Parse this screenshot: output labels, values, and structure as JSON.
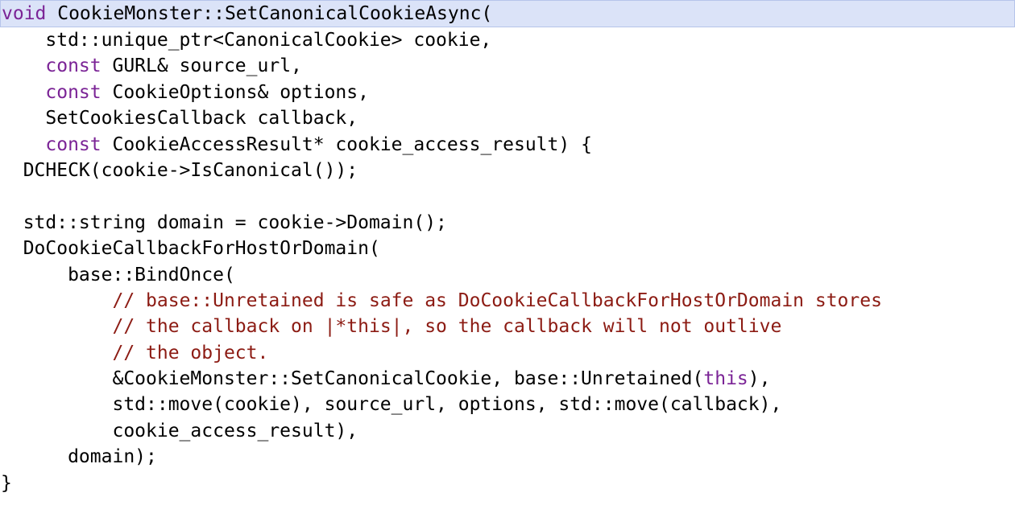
{
  "colors": {
    "keyword": "#7b2496",
    "comment": "#8c1b13",
    "text": "#000000",
    "highlight_background": "#dbe3f8",
    "highlight_border": "#b6c4ea"
  },
  "lines": [
    {
      "highlighted": true,
      "tokens": [
        {
          "t": "kw",
          "v": "void"
        },
        {
          "t": "plain",
          "v": " CookieMonster::SetCanonicalCookieAsync("
        }
      ]
    },
    {
      "tokens": [
        {
          "t": "plain",
          "v": "    std::unique_ptr<CanonicalCookie> cookie,"
        }
      ]
    },
    {
      "tokens": [
        {
          "t": "plain",
          "v": "    "
        },
        {
          "t": "kw",
          "v": "const"
        },
        {
          "t": "plain",
          "v": " GURL& source_url,"
        }
      ]
    },
    {
      "tokens": [
        {
          "t": "plain",
          "v": "    "
        },
        {
          "t": "kw",
          "v": "const"
        },
        {
          "t": "plain",
          "v": " CookieOptions& options,"
        }
      ]
    },
    {
      "tokens": [
        {
          "t": "plain",
          "v": "    SetCookiesCallback callback,"
        }
      ]
    },
    {
      "tokens": [
        {
          "t": "plain",
          "v": "    "
        },
        {
          "t": "kw",
          "v": "const"
        },
        {
          "t": "plain",
          "v": " CookieAccessResult* cookie_access_result) {"
        }
      ]
    },
    {
      "tokens": [
        {
          "t": "plain",
          "v": "  DCHECK(cookie->IsCanonical());"
        }
      ]
    },
    {
      "tokens": [
        {
          "t": "plain",
          "v": ""
        }
      ]
    },
    {
      "tokens": [
        {
          "t": "plain",
          "v": "  std::string domain = cookie->Domain();"
        }
      ]
    },
    {
      "tokens": [
        {
          "t": "plain",
          "v": "  DoCookieCallbackForHostOrDomain("
        }
      ]
    },
    {
      "tokens": [
        {
          "t": "plain",
          "v": "      base::BindOnce("
        }
      ]
    },
    {
      "tokens": [
        {
          "t": "plain",
          "v": "          "
        },
        {
          "t": "cm",
          "v": "// base::Unretained is safe as DoCookieCallbackForHostOrDomain stores"
        }
      ]
    },
    {
      "tokens": [
        {
          "t": "plain",
          "v": "          "
        },
        {
          "t": "cm",
          "v": "// the callback on |*this|, so the callback will not outlive"
        }
      ]
    },
    {
      "tokens": [
        {
          "t": "plain",
          "v": "          "
        },
        {
          "t": "cm",
          "v": "// the object."
        }
      ]
    },
    {
      "tokens": [
        {
          "t": "plain",
          "v": "          &CookieMonster::SetCanonicalCookie, base::Unretained("
        },
        {
          "t": "kw",
          "v": "this"
        },
        {
          "t": "plain",
          "v": "),"
        }
      ]
    },
    {
      "tokens": [
        {
          "t": "plain",
          "v": "          std::move(cookie), source_url, options, std::move(callback),"
        }
      ]
    },
    {
      "tokens": [
        {
          "t": "plain",
          "v": "          cookie_access_result),"
        }
      ]
    },
    {
      "tokens": [
        {
          "t": "plain",
          "v": "      domain);"
        }
      ]
    },
    {
      "tokens": [
        {
          "t": "plain",
          "v": "}"
        }
      ]
    }
  ]
}
